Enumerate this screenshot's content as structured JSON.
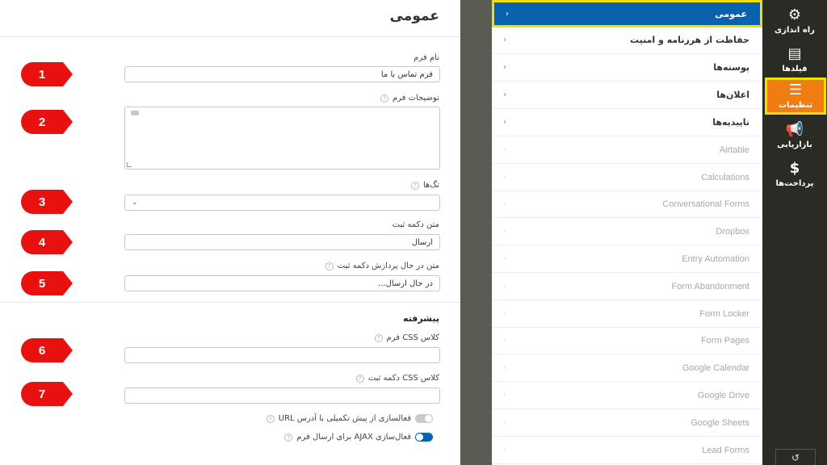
{
  "form_panel": {
    "title": "عمومی",
    "fields": [
      {
        "label": "نام فرم",
        "value": "فرم تماس با ما",
        "marker": "1"
      },
      {
        "label": "توضیحات فرم",
        "value": "",
        "marker": "2"
      },
      {
        "label": "تگ‌ها",
        "value": "",
        "marker": "3"
      },
      {
        "label": "متن دکمه ثبت",
        "value": "ارسال",
        "marker": "4"
      },
      {
        "label": "متن در حال پردازش دکمه ثبت",
        "value": "در حال ارسال...",
        "marker": "5"
      }
    ],
    "advanced_heading": "پیشرفته",
    "advanced_fields": [
      {
        "label": "کلاس CSS فرم",
        "value": "",
        "marker": "6"
      },
      {
        "label": "کلاس CSS دکمه ثبت",
        "value": "",
        "marker": "7"
      }
    ],
    "toggles": [
      {
        "label": "فعالسازی از پیش تکمیلی با آدرس URL",
        "on": false
      },
      {
        "label": "فعال‌سازی AJAX برای ارسال فرم",
        "on": true
      }
    ]
  },
  "settings_menu": {
    "items": [
      {
        "label": "عمومی",
        "active": true
      },
      {
        "label": "حفاظت از هرزنامه و امنیت"
      },
      {
        "label": "پوسته‌ها"
      },
      {
        "label": "اعلان‌ها"
      },
      {
        "label": "تاییدیه‌ها"
      },
      {
        "label": "Airtable",
        "disabled": true
      },
      {
        "label": "Calculations",
        "disabled": true
      },
      {
        "label": "Conversational Forms",
        "disabled": true
      },
      {
        "label": "Dropbox",
        "disabled": true
      },
      {
        "label": "Entry Automation",
        "disabled": true
      },
      {
        "label": "Form Abandonment",
        "disabled": true
      },
      {
        "label": "Form Locker",
        "disabled": true
      },
      {
        "label": "Form Pages",
        "disabled": true
      },
      {
        "label": "Google Calendar",
        "disabled": true
      },
      {
        "label": "Google Drive",
        "disabled": true
      },
      {
        "label": "Google Sheets",
        "disabled": true
      },
      {
        "label": "Lead Forms",
        "disabled": true
      }
    ]
  },
  "nav": {
    "items": [
      {
        "label": "راه اندازی",
        "icon": "gear-icon"
      },
      {
        "label": "فیلدها",
        "icon": "fields-icon"
      },
      {
        "label": "تنظیمات",
        "icon": "sliders-icon",
        "active": true
      },
      {
        "label": "بازاریابی",
        "icon": "megaphone-icon"
      },
      {
        "label": "پرداخت‌ها",
        "icon": "dollar-icon"
      }
    ],
    "bottom_icon": "history-icon"
  },
  "colors": {
    "accent_blue": "#0a62ad",
    "accent_orange": "#f07d14",
    "highlight": "#f0e000",
    "marker_red": "#e8110f"
  }
}
